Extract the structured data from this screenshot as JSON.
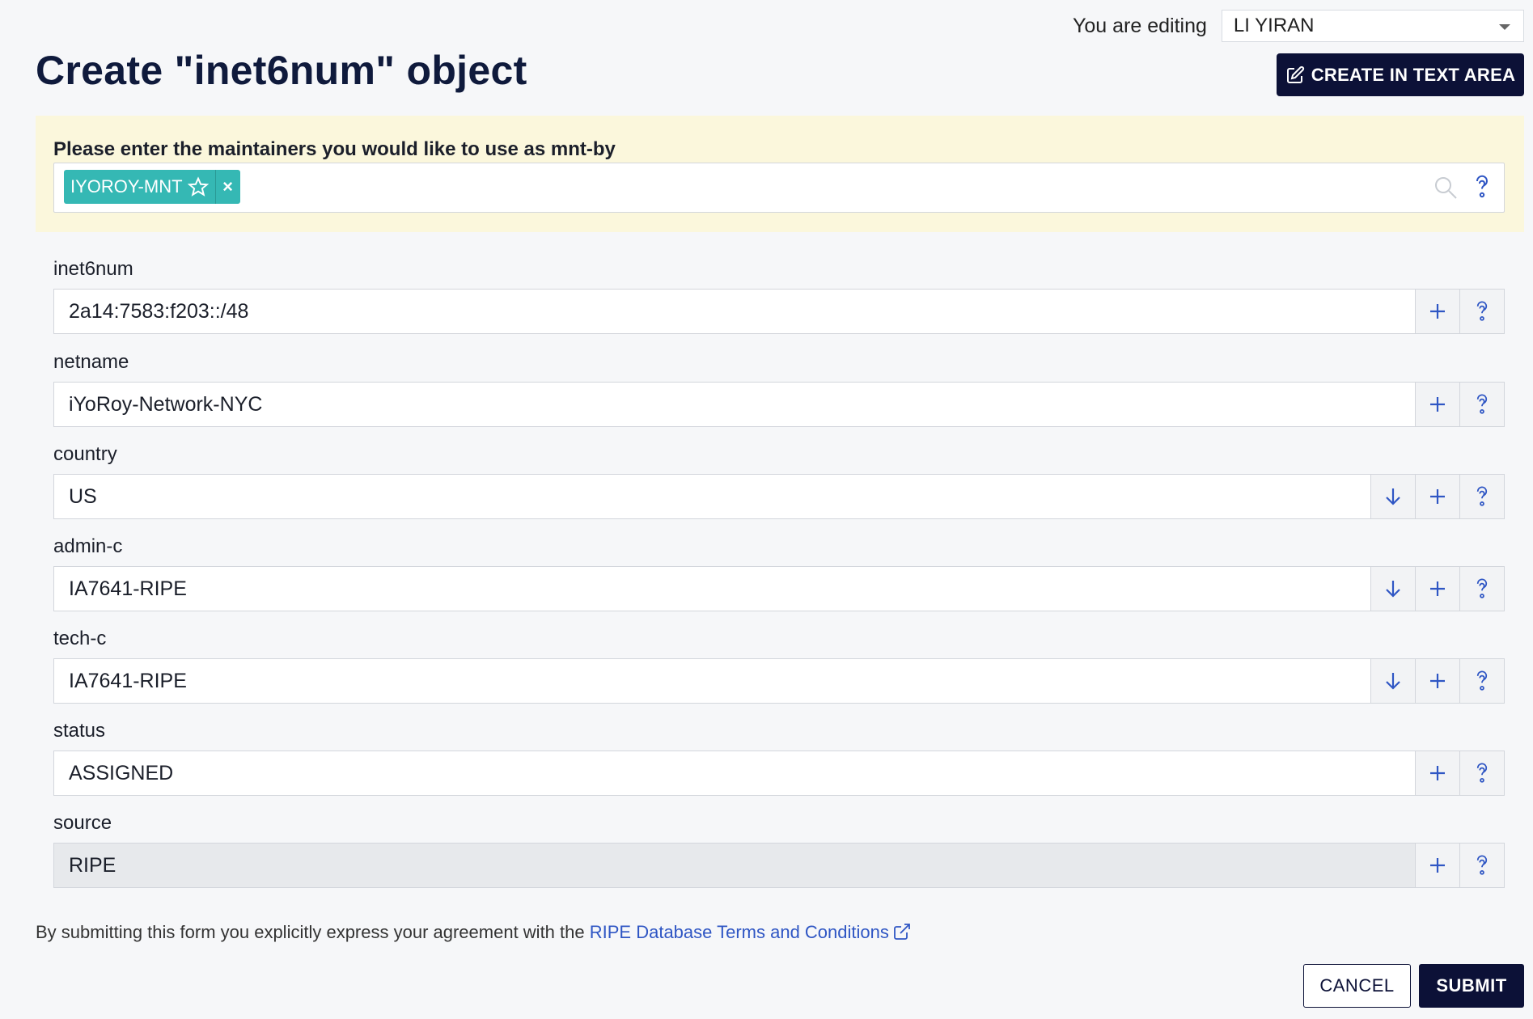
{
  "header": {
    "editing_label": "You are editing",
    "editing_value": "LI YIRAN",
    "title": "Create \"inet6num\" object",
    "create_text_area_label": "CREATE IN TEXT AREA"
  },
  "maintainers": {
    "label": "Please enter the maintainers you would like to use as mnt-by",
    "chips": [
      {
        "label": "IYOROY-MNT",
        "remove": "×"
      }
    ]
  },
  "fields": [
    {
      "label": "inet6num",
      "value": "2a14:7583:f203::/48",
      "dropdown": false,
      "readonly": false
    },
    {
      "label": "netname",
      "value": "iYoRoy-Network-NYC",
      "dropdown": false,
      "readonly": false
    },
    {
      "label": "country",
      "value": "US",
      "dropdown": true,
      "readonly": false
    },
    {
      "label": "admin-c",
      "value": "IA7641-RIPE",
      "dropdown": true,
      "readonly": false
    },
    {
      "label": "tech-c",
      "value": "IA7641-RIPE",
      "dropdown": true,
      "readonly": false
    },
    {
      "label": "status",
      "value": "ASSIGNED",
      "dropdown": false,
      "readonly": false
    },
    {
      "label": "source",
      "value": "RIPE",
      "dropdown": false,
      "readonly": true
    }
  ],
  "footer": {
    "terms_prefix": "By submitting this form you explicitly express your agreement with the",
    "terms_link": "RIPE Database Terms and Conditions",
    "cancel_label": "CANCEL",
    "submit_label": "SUBMIT"
  },
  "colors": {
    "accent": "#0c1137",
    "chip": "#35b8b4",
    "panel": "#fbf7dc",
    "link": "#2f56c4",
    "icon": "#2f56c4"
  },
  "icons": {
    "edit": "edit-icon",
    "star": "star-outline-icon",
    "search": "search-icon",
    "help": "help-icon",
    "add": "plus-icon",
    "dropdown": "arrow-down-icon",
    "external": "external-link-icon"
  }
}
